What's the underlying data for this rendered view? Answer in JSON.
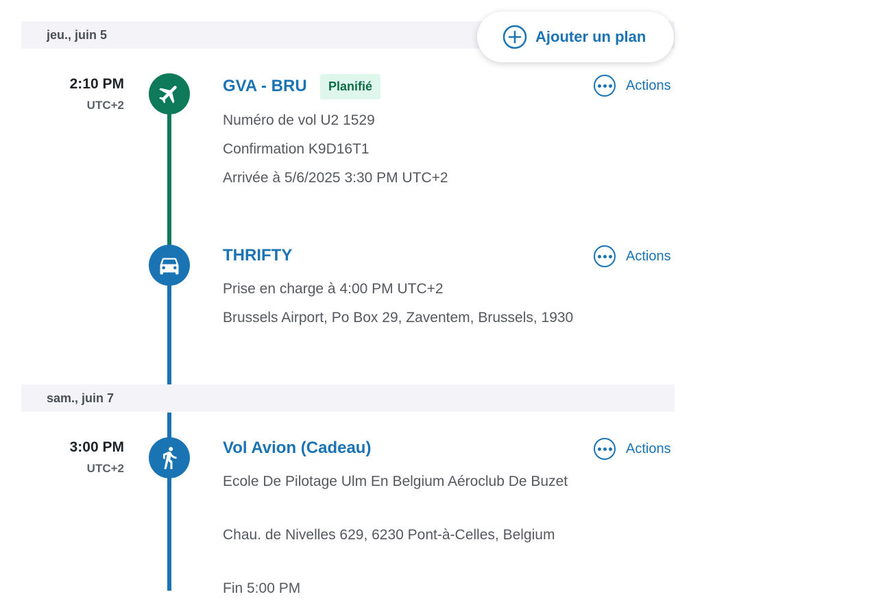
{
  "add_plan": {
    "label": "Ajouter un plan",
    "icon": "plus-circle-icon"
  },
  "colors": {
    "flight": "#0f7a5a",
    "primary": "#1a73b3",
    "badge_bg": "#dff6ec",
    "badge_text": "#0c6e49"
  },
  "days": [
    {
      "label": "jeu., juin 5"
    },
    {
      "label": "sam., juin 7"
    }
  ],
  "items": [
    {
      "time": "2:10 PM",
      "tz": "UTC+2",
      "icon": "airplane-icon",
      "title": "GVA - BRU",
      "badge": "Planifié",
      "details": [
        "Numéro de vol U2 1529",
        "Confirmation K9D16T1",
        "Arrivée à 5/6/2025 3:30 PM UTC+2"
      ],
      "actions": "Actions"
    },
    {
      "icon": "car-icon",
      "title": "THRIFTY",
      "details": [
        "Prise en charge à 4:00 PM UTC+2",
        "Brussels Airport, Po Box 29, Zaventem, Brussels, 1930"
      ],
      "actions": "Actions"
    },
    {
      "time": "3:00 PM",
      "tz": "UTC+2",
      "icon": "walking-person-icon",
      "title": "Vol Avion (Cadeau)",
      "details": [
        "Ecole De Pilotage Ulm En Belgium Aéroclub De Buzet",
        "Chau. de Nivelles 629, 6230 Pont-à-Celles, Belgium",
        "Fin 5:00 PM"
      ],
      "actions": "Actions"
    }
  ]
}
